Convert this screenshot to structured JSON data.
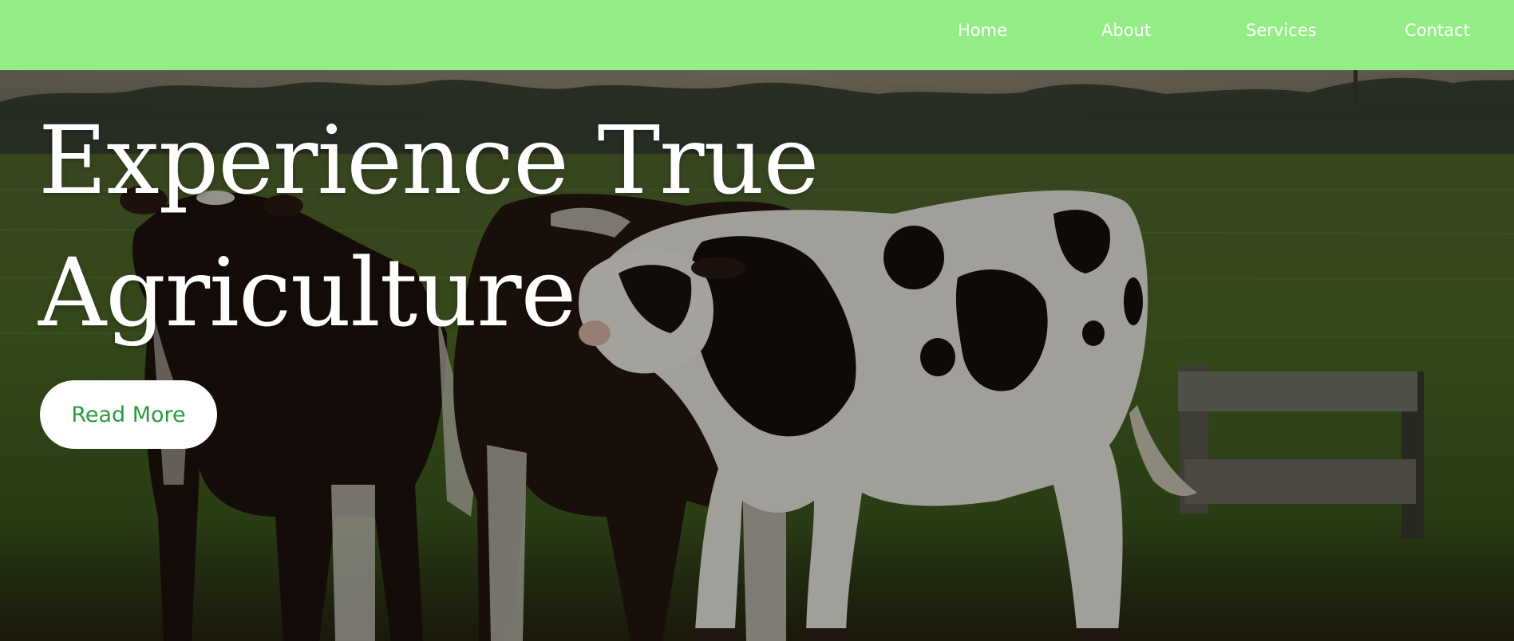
{
  "nav": {
    "items": [
      {
        "label": "Home"
      },
      {
        "label": "About"
      },
      {
        "label": "Services"
      },
      {
        "label": "Contact"
      }
    ],
    "background_color": "#93ee85"
  },
  "hero": {
    "title_line_1": "Experience True",
    "title_line_2": "Agriculture",
    "button_label": "Read More",
    "button_text_color": "#2a9a3c",
    "background_image": "cows-in-pasture-photo"
  }
}
